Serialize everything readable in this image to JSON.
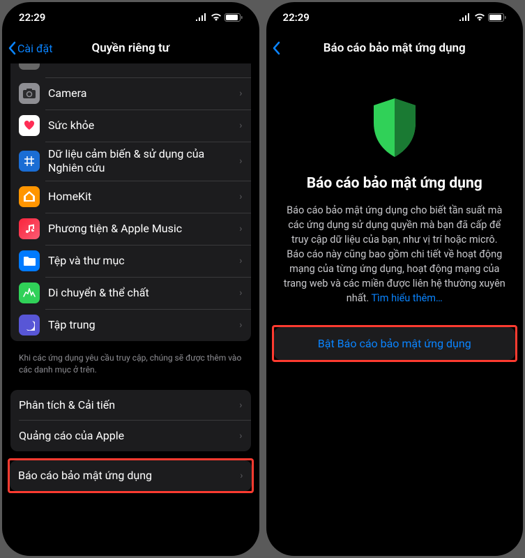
{
  "statusTime": "22:29",
  "left": {
    "backLabel": "Cài đặt",
    "title": "Quyền riêng tư",
    "rows": [
      {
        "label": "Camera"
      },
      {
        "label": "Sức khỏe"
      },
      {
        "label": "Dữ liệu cảm biến & sử dụng của Nghiên cứu"
      },
      {
        "label": "HomeKit"
      },
      {
        "label": "Phương tiện & Apple Music"
      },
      {
        "label": "Tệp và thư mục"
      },
      {
        "label": "Di chuyển & thể chất"
      },
      {
        "label": "Tập trung"
      }
    ],
    "footer": "Khi các ứng dụng yêu cầu truy cập, chúng sẽ được thêm vào các danh mục ở trên.",
    "group2": [
      {
        "label": "Phân tích & Cải tiến"
      },
      {
        "label": "Quảng cáo của Apple"
      }
    ],
    "group3": [
      {
        "label": "Báo cáo bảo mật ứng dụng"
      }
    ]
  },
  "right": {
    "title": "Báo cáo bảo mật ứng dụng",
    "heading": "Báo cáo bảo mật ứng dụng",
    "body": "Báo cáo bảo mật ứng dụng cho biết tần suất mà các ứng dụng sử dụng quyền mà bạn đã cấp để truy cập dữ liệu của bạn, như vị trí hoặc micrô. Báo cáo này cũng bao gồm chi tiết về hoạt động mạng của từng ứng dụng, hoạt động mạng của trang web và các miền được liên hệ thường xuyên nhất. ",
    "learnMore": "Tìm hiểu thêm…",
    "enable": "Bật Báo cáo bảo mật ứng dụng"
  }
}
